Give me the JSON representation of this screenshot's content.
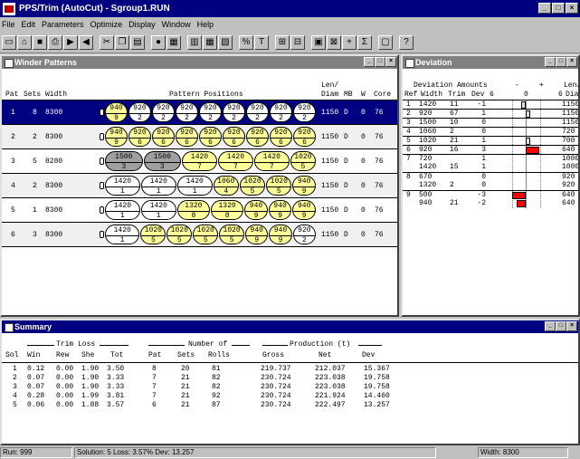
{
  "window": {
    "title": "PPS/Trim (AutoCut)  - Sgroup1.RUN"
  },
  "menu": [
    "File",
    "Edit",
    "Parameters",
    "Optimize",
    "Display",
    "Window",
    "Help"
  ],
  "toolbar": [
    {
      "name": "new-doc-icon",
      "glyph": "▭"
    },
    {
      "name": "open-folder-icon",
      "glyph": "⌂"
    },
    {
      "name": "save-icon",
      "glyph": "■"
    },
    {
      "name": "print-icon",
      "glyph": "⎙"
    },
    {
      "name": "import-icon",
      "glyph": "▶"
    },
    {
      "name": "export-icon",
      "glyph": "◀"
    },
    {
      "name": "cut-icon",
      "glyph": "✂"
    },
    {
      "name": "copy-icon",
      "glyph": "❐"
    },
    {
      "name": "paste-icon",
      "glyph": "▤"
    },
    {
      "name": "record-icon",
      "glyph": "●"
    },
    {
      "name": "chart-icon",
      "glyph": "▦"
    },
    {
      "name": "grid-icon",
      "glyph": "▥"
    },
    {
      "name": "table-icon",
      "glyph": "▦"
    },
    {
      "name": "layout-icon",
      "glyph": "▧"
    },
    {
      "name": "percent-icon",
      "glyph": "%"
    },
    {
      "name": "trim-icon",
      "glyph": "T"
    },
    {
      "name": "arrange-icon",
      "glyph": "⊞"
    },
    {
      "name": "stack-icon",
      "glyph": "⊟"
    },
    {
      "name": "summary-icon",
      "glyph": "▣"
    },
    {
      "name": "tile-icon",
      "glyph": "⊠"
    },
    {
      "name": "plus-icon",
      "glyph": "+"
    },
    {
      "name": "sigma-icon",
      "glyph": "Σ"
    },
    {
      "name": "window-icon",
      "glyph": "▢"
    },
    {
      "name": "help-icon",
      "glyph": "?"
    }
  ],
  "winder": {
    "title": "Winder Patterns",
    "header1": "Len/",
    "header2": {
      "pat": "Pat",
      "sets": "Sets",
      "width": "Width",
      "positions": "Pattern Positions",
      "diam": "Diam",
      "mb": "MB",
      "w": "W",
      "core": "Core"
    },
    "rows": [
      {
        "pat": "1",
        "sets": "8",
        "width": "8300",
        "cells": [
          {
            "w": "940",
            "k": "9",
            "c": "y",
            "span": 1
          },
          {
            "w": "920",
            "k": "2",
            "c": "w",
            "span": 1
          },
          {
            "w": "920",
            "k": "2",
            "c": "w",
            "span": 1
          },
          {
            "w": "920",
            "k": "2",
            "c": "w",
            "span": 1
          },
          {
            "w": "920",
            "k": "2",
            "c": "w",
            "span": 1
          },
          {
            "w": "920",
            "k": "2",
            "c": "w",
            "span": 1
          },
          {
            "w": "920",
            "k": "2",
            "c": "w",
            "span": 1
          },
          {
            "w": "920",
            "k": "2",
            "c": "w",
            "span": 1
          },
          {
            "w": "920",
            "k": "2",
            "c": "w",
            "span": 1
          }
        ],
        "diam": "1150",
        "mb": "D",
        "w": "0",
        "core": "76"
      },
      {
        "pat": "2",
        "sets": "2",
        "width": "8300",
        "cells": [
          {
            "w": "940",
            "k": "9",
            "c": "y",
            "span": 1
          },
          {
            "w": "920",
            "k": "6",
            "c": "y",
            "span": 1
          },
          {
            "w": "920",
            "k": "6",
            "c": "y",
            "span": 1
          },
          {
            "w": "920",
            "k": "6",
            "c": "y",
            "span": 1
          },
          {
            "w": "920",
            "k": "6",
            "c": "y",
            "span": 1
          },
          {
            "w": "920",
            "k": "6",
            "c": "y",
            "span": 1
          },
          {
            "w": "920",
            "k": "6",
            "c": "y",
            "span": 1
          },
          {
            "w": "920",
            "k": "6",
            "c": "y",
            "span": 1
          },
          {
            "w": "920",
            "k": "6",
            "c": "y",
            "span": 1
          }
        ],
        "diam": "1150",
        "mb": "D",
        "w": "0",
        "core": "76"
      },
      {
        "pat": "3",
        "sets": "5",
        "width": "8280",
        "cells": [
          {
            "w": "1500",
            "k": "3",
            "c": "g",
            "span": 1.6
          },
          {
            "w": "1500",
            "k": "3",
            "c": "g",
            "span": 1.6
          },
          {
            "w": "1420",
            "k": "7",
            "c": "y",
            "span": 1.5
          },
          {
            "w": "1420",
            "k": "7",
            "c": "y",
            "span": 1.5
          },
          {
            "w": "1420",
            "k": "7",
            "c": "y",
            "span": 1.5
          },
          {
            "w": "1020",
            "k": "5",
            "c": "y",
            "span": 1.1
          }
        ],
        "diam": "1150",
        "mb": "D",
        "w": "0",
        "core": "76"
      },
      {
        "pat": "4",
        "sets": "2",
        "width": "8300",
        "cells": [
          {
            "w": "1420",
            "k": "1",
            "c": "w",
            "span": 1.5
          },
          {
            "w": "1420",
            "k": "1",
            "c": "w",
            "span": 1.5
          },
          {
            "w": "1420",
            "k": "1",
            "c": "w",
            "span": 1.5
          },
          {
            "w": "1060",
            "k": "4",
            "c": "y",
            "span": 1.1
          },
          {
            "w": "1020",
            "k": "5",
            "c": "y",
            "span": 1.1
          },
          {
            "w": "1020",
            "k": "5",
            "c": "y",
            "span": 1.1
          },
          {
            "w": "940",
            "k": "9",
            "c": "y",
            "span": 1
          }
        ],
        "diam": "1150",
        "mb": "D",
        "w": "0",
        "core": "76"
      },
      {
        "pat": "5",
        "sets": "1",
        "width": "8300",
        "cells": [
          {
            "w": "1420",
            "k": "1",
            "c": "w",
            "span": 1.5
          },
          {
            "w": "1420",
            "k": "1",
            "c": "w",
            "span": 1.5
          },
          {
            "w": "1320",
            "k": "8",
            "c": "y",
            "span": 1.4
          },
          {
            "w": "1320",
            "k": "8",
            "c": "y",
            "span": 1.4
          },
          {
            "w": "940",
            "k": "9",
            "c": "y",
            "span": 1
          },
          {
            "w": "940",
            "k": "9",
            "c": "y",
            "span": 1
          },
          {
            "w": "940",
            "k": "9",
            "c": "y",
            "span": 1
          }
        ],
        "diam": "1150",
        "mb": "D",
        "w": "0",
        "core": "76"
      },
      {
        "pat": "6",
        "sets": "3",
        "width": "8300",
        "cells": [
          {
            "w": "1420",
            "k": "1",
            "c": "w",
            "span": 1.5
          },
          {
            "w": "1020",
            "k": "5",
            "c": "y",
            "span": 1.1
          },
          {
            "w": "1020",
            "k": "5",
            "c": "y",
            "span": 1.1
          },
          {
            "w": "1020",
            "k": "5",
            "c": "y",
            "span": 1.1
          },
          {
            "w": "1020",
            "k": "5",
            "c": "y",
            "span": 1.1
          },
          {
            "w": "940",
            "k": "9",
            "c": "y",
            "span": 1
          },
          {
            "w": "940",
            "k": "9",
            "c": "y",
            "span": 1
          },
          {
            "w": "920",
            "k": "2",
            "c": "w",
            "span": 1
          }
        ],
        "diam": "1150",
        "mb": "D",
        "w": "0",
        "core": "76"
      }
    ]
  },
  "deviation": {
    "title": "Deviation",
    "header1": {
      "label": "Deviation Amounts",
      "minus": "-",
      "plus": "+",
      "len": "Len/"
    },
    "header2": {
      "ref": "Ref",
      "width": "Width",
      "trim": "Trim",
      "dev": "Dev",
      "six": "6",
      "zero": "0",
      "six2": "6",
      "diam": "Diam"
    },
    "rows": [
      {
        "ref": "1",
        "width": "1420",
        "trim": "11",
        "dev": "-1",
        "diam": "1150",
        "bar": -1,
        "red": false,
        "top": true
      },
      {
        "ref": "2",
        "width": "920",
        "trim": "67",
        "dev": "1",
        "diam": "1150",
        "bar": 1,
        "red": false,
        "top": true
      },
      {
        "ref": "3",
        "width": "1500",
        "trim": "10",
        "dev": "0",
        "diam": "1150",
        "bar": 0,
        "red": false,
        "top": true
      },
      {
        "ref": "4",
        "width": "1060",
        "trim": "2",
        "dev": "0",
        "diam": "720",
        "bar": 0,
        "red": false,
        "top": true
      },
      {
        "ref": "5",
        "width": "1020",
        "trim": "21",
        "dev": "1",
        "diam": "700",
        "bar": 1,
        "red": false,
        "top": true
      },
      {
        "ref": "6",
        "width": "920",
        "trim": "16",
        "dev": "3",
        "diam": "640",
        "bar": 3,
        "red": true,
        "top": true
      },
      {
        "ref": "7",
        "width": "720",
        "trim": "",
        "dev": "1",
        "diam": "1000",
        "bar": 0,
        "red": false,
        "top": true
      },
      {
        "ref": "",
        "width": "1420",
        "trim": "15",
        "dev": "1",
        "diam": "1000",
        "bar": 0,
        "red": false,
        "top": false
      },
      {
        "ref": "8",
        "width": "670",
        "trim": "",
        "dev": "0",
        "diam": "920",
        "bar": 0,
        "red": false,
        "top": true
      },
      {
        "ref": "",
        "width": "1320",
        "trim": "2",
        "dev": "0",
        "diam": "920",
        "bar": 0,
        "red": false,
        "top": false
      },
      {
        "ref": "9",
        "width": "500",
        "trim": "",
        "dev": "-3",
        "diam": "640",
        "bar": -3,
        "red": true,
        "top": true
      },
      {
        "ref": "",
        "width": "940",
        "trim": "21",
        "dev": "-2",
        "diam": "640",
        "bar": -2,
        "red": true,
        "top": false
      }
    ]
  },
  "summary": {
    "title": "Summary",
    "group1": "Trim Loss",
    "group2": "Number of",
    "group3": "Production (t)",
    "cols": {
      "sol": "Sol",
      "win": "Win",
      "rew": "Rew",
      "she": "She",
      "tot": "Tot",
      "pat": "Pat",
      "sets": "Sets",
      "rolls": "Rolls",
      "gross": "Gross",
      "net": "Net",
      "dev": "Dev"
    },
    "rows": [
      {
        "sol": "1",
        "win": "0.12",
        "rew": "0.00",
        "she": "1.90",
        "tot": "3.50",
        "pat": "8",
        "sets": "20",
        "rolls": "81",
        "gross": "219.737",
        "net": "212.037",
        "dev": "15.367"
      },
      {
        "sol": "2",
        "win": "0.07",
        "rew": "0.00",
        "she": "1.90",
        "tot": "3.33",
        "pat": "7",
        "sets": "21",
        "rolls": "82",
        "gross": "230.724",
        "net": "223.038",
        "dev": "19.758"
      },
      {
        "sol": "3",
        "win": "0.07",
        "rew": "0.00",
        "she": "1.90",
        "tot": "3.33",
        "pat": "7",
        "sets": "21",
        "rolls": "82",
        "gross": "230.724",
        "net": "223.038",
        "dev": "19.758"
      },
      {
        "sol": "4",
        "win": "0.28",
        "rew": "0.00",
        "she": "1.99",
        "tot": "3.81",
        "pat": "7",
        "sets": "21",
        "rolls": "92",
        "gross": "230.724",
        "net": "221.924",
        "dev": "14.460"
      },
      {
        "sol": "5",
        "win": "0.06",
        "rew": "0.00",
        "she": "1.88",
        "tot": "3.57",
        "pat": "6",
        "sets": "21",
        "rolls": "87",
        "gross": "230.724",
        "net": "222.497",
        "dev": "13.257"
      }
    ]
  },
  "status": {
    "run": "Run: 999",
    "solution": "Solution: 5  Loss: 3.57%  Dev: 13.257",
    "width": "Width: 8300"
  }
}
